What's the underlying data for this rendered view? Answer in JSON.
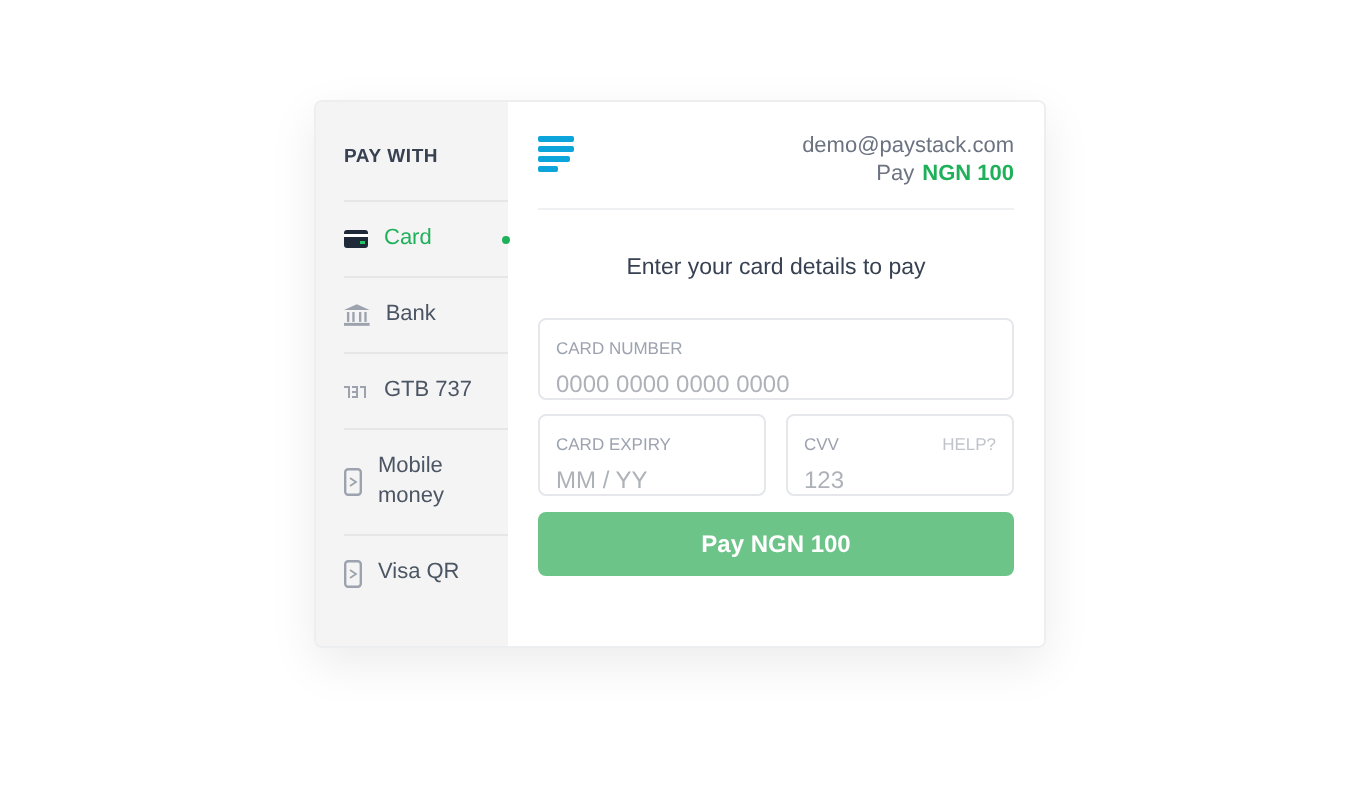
{
  "sidebar": {
    "title": "PAY WITH",
    "items": [
      {
        "label": "Card",
        "kind": "card",
        "selected": true
      },
      {
        "label": "Bank",
        "kind": "bank",
        "selected": false
      },
      {
        "label": "GTB 737",
        "kind": "ussd",
        "selected": false
      },
      {
        "label": "Mobile money",
        "kind": "phone",
        "selected": false
      },
      {
        "label": "Visa QR",
        "kind": "qr",
        "selected": false
      }
    ]
  },
  "header": {
    "email": "demo@paystack.com",
    "pay_label": "Pay",
    "amount": "NGN 100"
  },
  "heading": "Enter your card details to pay",
  "fields": {
    "card_number": {
      "label": "CARD NUMBER",
      "placeholder": "0000 0000 0000 0000"
    },
    "expiry": {
      "label": "CARD EXPIRY",
      "placeholder": "MM / YY"
    },
    "cvv": {
      "label": "CVV",
      "placeholder": "123",
      "help": "HELP?"
    }
  },
  "pay_button": "Pay NGN 100"
}
